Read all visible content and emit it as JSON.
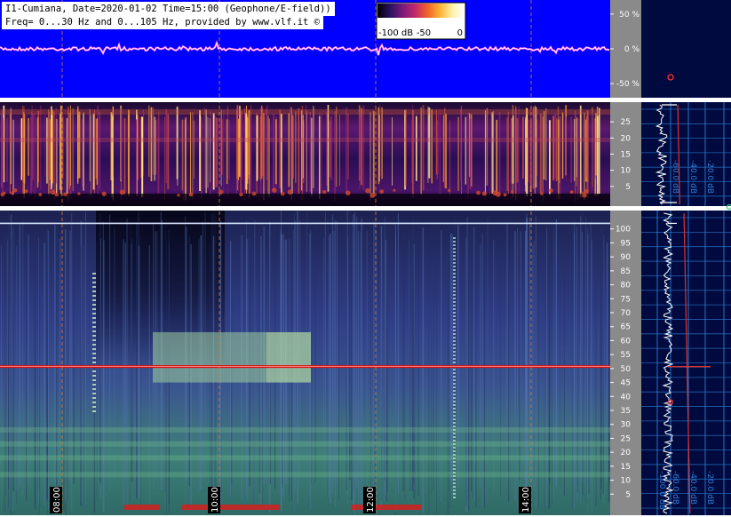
{
  "header": {
    "line1": "I1-Cumiana, Date=2020-01-02 Time=15:00 (Geophone/E-field))",
    "line2": "Freq= 0...30 Hz and 0...105 Hz, provided by www.vlf.it ©"
  },
  "colorbar": {
    "labels": [
      "-100 dB",
      "-50",
      "0"
    ],
    "stops": [
      "#000000",
      "#2b1160",
      "#7b1a7a",
      "#c1276b",
      "#f0602a",
      "#fbb131",
      "#fff1a8",
      "#ffffff"
    ]
  },
  "colors": {
    "top_bg": "#0000ff",
    "gutter": "#8a8a8a",
    "side_bg": "#000a3e",
    "profile_grid": "#2e7fd8",
    "grid_hour": "#c8783c",
    "line_50hz": "#e01010"
  },
  "chart_data": [
    {
      "type": "line",
      "title": "",
      "y_axis_ticks": [
        "50 %",
        "0 %",
        "-50 %"
      ],
      "y_values_percent": [
        50,
        0,
        -50
      ]
    },
    {
      "type": "heatmap",
      "title": "",
      "y_ticks": [
        5,
        10,
        15,
        20,
        25
      ],
      "ylim": [
        0,
        30
      ],
      "profile_db_ticks": [
        "-60.0 dB",
        "-40.0 dB",
        "-20.0 dB"
      ]
    },
    {
      "type": "heatmap",
      "title": "",
      "y_ticks": [
        5,
        10,
        15,
        20,
        25,
        30,
        35,
        40,
        45,
        50,
        55,
        60,
        65,
        70,
        75,
        80,
        85,
        90,
        95,
        100
      ],
      "ylim": [
        0,
        105
      ],
      "x_time_labels": [
        "08:00",
        "10:00",
        "12:00",
        "14:00"
      ],
      "profile_db_ticks": [
        "-100.0 dB",
        "-60.0 dB",
        "-40.0 dB",
        "-20.0 dB"
      ],
      "features": {
        "power_line_hz": 50.7,
        "top_line_hz": 102,
        "broadband_block_hz": [
          45,
          63
        ]
      }
    }
  ]
}
